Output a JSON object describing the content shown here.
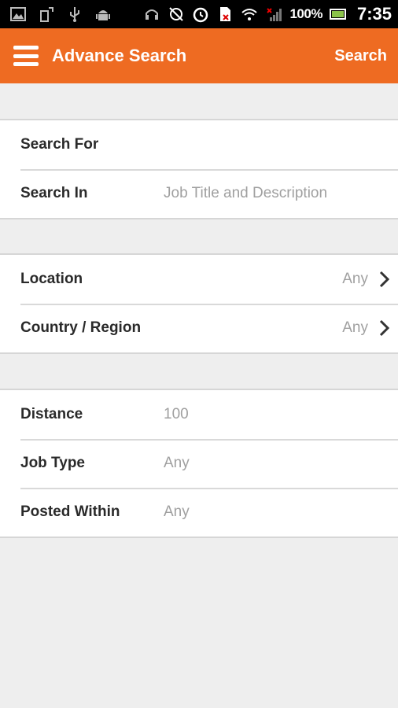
{
  "status_bar": {
    "battery": "100%",
    "time": "7:35",
    "icons": [
      "image-icon",
      "rotate-icon",
      "usb-icon",
      "android-icon",
      "headset-icon",
      "sync-off-icon",
      "alarm-icon",
      "sim-icon",
      "wifi-icon",
      "signal-icon",
      "battery-icon"
    ]
  },
  "app_bar": {
    "title": "Advance Search",
    "action_label": "Search",
    "background": "#ee6b22"
  },
  "sections": {
    "search": {
      "search_for": {
        "label": "Search For",
        "value": ""
      },
      "search_in": {
        "label": "Search In",
        "value": "Job Title and Description"
      }
    },
    "location": {
      "location": {
        "label": "Location",
        "value": "Any"
      },
      "country_region": {
        "label": "Country / Region",
        "value": "Any"
      }
    },
    "filters": {
      "distance": {
        "label": "Distance",
        "value": "100"
      },
      "job_type": {
        "label": "Job Type",
        "value": "Any"
      },
      "posted_within": {
        "label": "Posted Within",
        "value": "Any"
      }
    }
  }
}
